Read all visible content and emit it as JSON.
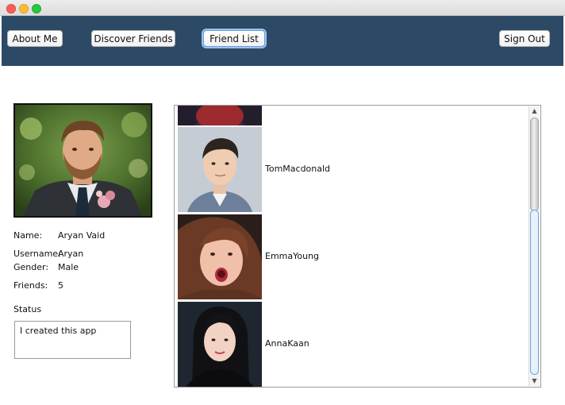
{
  "toolbar": {
    "about_me": "About Me",
    "discover_friends": "Discover Friends",
    "friend_list": "Friend List",
    "sign_out": "Sign Out",
    "background_color": "#2c4a66"
  },
  "profile": {
    "name_label": "Name:",
    "name_value": "Aryan Vaid",
    "username_label": "Username:",
    "username_value": "Aryan",
    "gender_label": "Gender:",
    "gender_value": "Male",
    "friends_label": "Friends:",
    "friends_value": "5",
    "status_label": "Status",
    "status_value": "I created this app"
  },
  "friends": [
    {
      "name": ""
    },
    {
      "name": "TomMacdonald"
    },
    {
      "name": "EmmaYoung"
    },
    {
      "name": "AnnaKaan"
    }
  ]
}
